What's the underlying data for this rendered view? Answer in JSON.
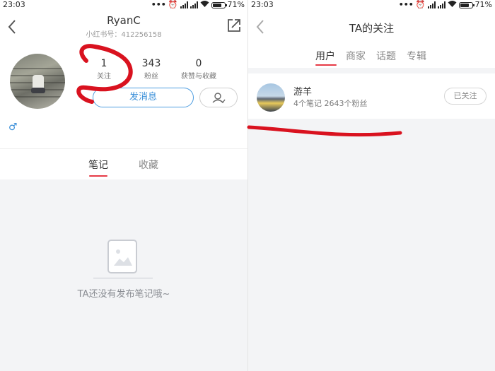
{
  "left": {
    "status_bar": {
      "time": "23:03",
      "battery": "71%"
    },
    "header": {
      "title": "RyanC",
      "subtitle": "小红书号：412256158"
    },
    "stats": [
      {
        "value": "1",
        "label": "关注"
      },
      {
        "value": "343",
        "label": "粉丝"
      },
      {
        "value": "0",
        "label": "获赞与收藏"
      }
    ],
    "message_button": "发消息",
    "gender_symbol": "♂",
    "tabs": [
      "笔记",
      "收藏"
    ],
    "active_tab": 0,
    "empty_text": "TA还没有发布笔记哦~"
  },
  "right": {
    "status_bar": {
      "time": "23:03",
      "battery": "71%"
    },
    "header": {
      "title": "TA的关注"
    },
    "tabs": [
      "用户",
      "商家",
      "话题",
      "专辑"
    ],
    "active_tab": 0,
    "users": [
      {
        "name": "游羊",
        "meta": "4个笔记  2643个粉丝",
        "follow_label": "已关注"
      }
    ]
  },
  "colors": {
    "accent_red": "#e63a46",
    "accent_blue": "#3a8fd9",
    "annotation_red": "#d9121f",
    "page_bg": "#f3f4f6"
  }
}
